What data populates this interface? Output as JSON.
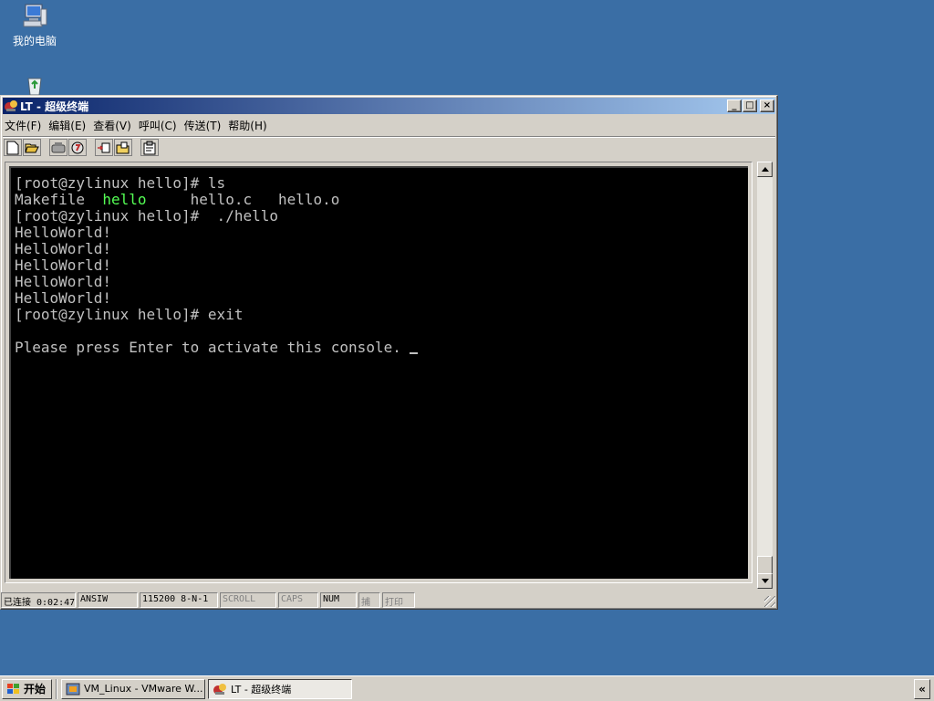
{
  "desktop": {
    "icons": [
      {
        "label": "我的电脑",
        "icon": "my-computer-icon"
      },
      {
        "label": "",
        "icon": "recycle-bin-icon"
      }
    ],
    "background_color": "#3a6ea5"
  },
  "window": {
    "title": "LT - 超级终端",
    "controls": {
      "minimize": "_",
      "maximize": "□",
      "close": "×"
    },
    "menu": [
      "文件(F)",
      "编辑(E)",
      "查看(V)",
      "呼叫(C)",
      "传送(T)",
      "帮助(H)"
    ],
    "toolbar": [
      "new-icon",
      "open-icon",
      "disconnect-icon",
      "dial-icon",
      "send-icon",
      "receive-icon",
      "properties-icon"
    ],
    "terminal": {
      "prompt1": "[root@zylinux hello]# ls",
      "ls_makefile": "Makefile  ",
      "ls_hello": "hello",
      "ls_rest": "     hello.c   hello.o",
      "prompt2": "[root@zylinux hello]#  ./hello",
      "output": [
        "HelloWorld!",
        "HelloWorld!",
        "HelloWorld!",
        "HelloWorld!",
        "HelloWorld!"
      ],
      "prompt3": "[root@zylinux hello]# exit",
      "blank": "",
      "activate": "Please press Enter to activate this console. ",
      "highlight_color": "#55ff55"
    },
    "status": {
      "connected": "已连接 0:02:47",
      "emulation": "ANSIW",
      "port": "115200 8-N-1",
      "scroll": "SCROLL",
      "caps": "CAPS",
      "num": "NUM",
      "capture": "捕",
      "print": "打印"
    }
  },
  "taskbar": {
    "start": "开始",
    "tasks": [
      {
        "label": "VM_Linux - VMware W...",
        "active": false
      },
      {
        "label": "LT - 超级终端",
        "active": true
      }
    ],
    "tray_button": "«"
  }
}
